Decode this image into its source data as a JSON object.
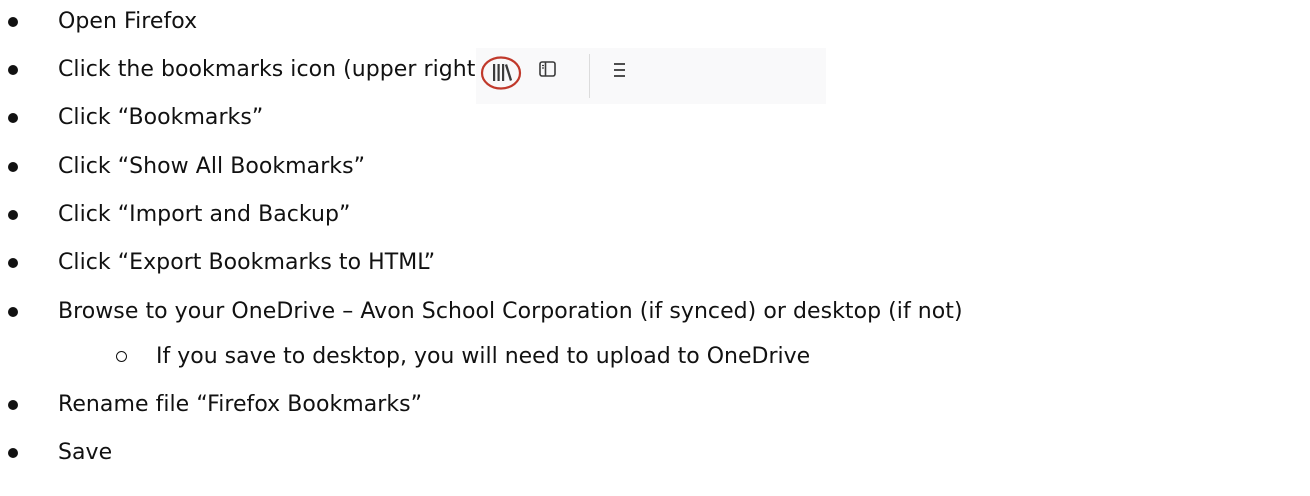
{
  "steps": [
    {
      "text": "Open Firefox"
    },
    {
      "text": "Click the bookmarks icon (upper right)"
    },
    {
      "text": "Click “Bookmarks”"
    },
    {
      "text": "Click “Show All Bookmarks”"
    },
    {
      "text": "Click “Import and Backup”"
    },
    {
      "text": "Click “Export Bookmarks to HTML”"
    },
    {
      "text": "Browse to your OneDrive – Avon School Corporation (if synced) or desktop (if not)"
    },
    {
      "text": "If you save to desktop, you will need to upload to OneDrive"
    },
    {
      "text": "Rename file “Firefox Bookmarks”"
    },
    {
      "text": "Save"
    }
  ],
  "toolbar": {
    "icons": [
      "library-icon",
      "sidebar-icon",
      "hamburger-menu-icon"
    ],
    "highlight_color": "#c0392b",
    "icon_color": "#3b3b3b",
    "background": "#f9f9fa"
  }
}
